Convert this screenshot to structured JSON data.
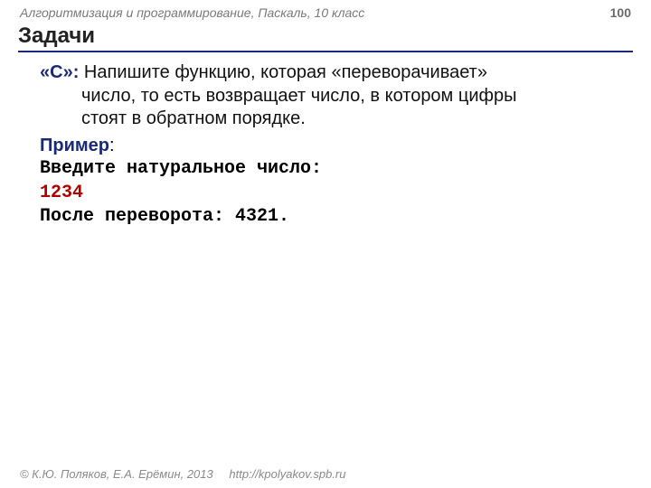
{
  "header": {
    "course": "Алгоритмизация и программирование, Паскаль, 10 класс",
    "page_number": "100"
  },
  "title": "Задачи",
  "task": {
    "label": "«С»",
    "colon": ":",
    "text_first": " Напишите функцию, которая «переворачивает»",
    "text_indent1": "число, то есть возвращает число, в котором цифры",
    "text_indent2": "стоят в обратном порядке."
  },
  "example": {
    "label": "Пример",
    "colon": ":",
    "line1": "Введите натуральное число:",
    "line2": "1234",
    "line3": "После переворота: 4321."
  },
  "footer": {
    "copyright": "© К.Ю. Поляков, Е.А. Ерёмин, 2013",
    "url": "http://kpolyakov.spb.ru"
  }
}
